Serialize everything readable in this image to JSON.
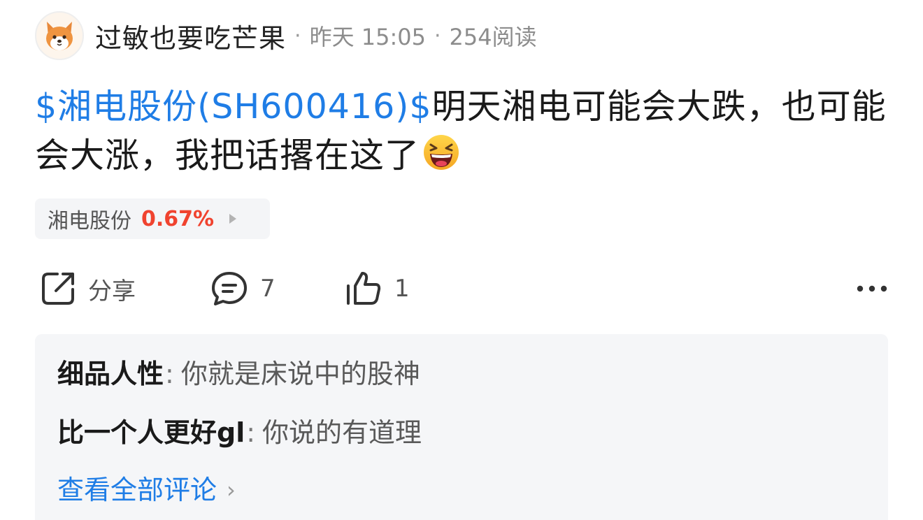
{
  "author": {
    "name": "过敏也要吃芒果",
    "time": "昨天 15:05",
    "reads": "254阅读",
    "separator": "·"
  },
  "post": {
    "stock_link": "$湘电股份(SH600416)$",
    "text": "明天湘电可能会大跌，也可能会大涨，我把话撂在这了"
  },
  "stock_chip": {
    "name": "湘电股份",
    "change": "0.67%"
  },
  "actions": {
    "share_label": "分享",
    "comment_count": "7",
    "like_count": "1"
  },
  "comments": [
    {
      "user": "细品人性",
      "separator": ":",
      "text": "你就是床说中的股神"
    },
    {
      "user": "比一个人更好gl",
      "separator": ":",
      "text": "你说的有道理"
    }
  ],
  "view_all_label": "查看全部评论",
  "colors": {
    "link_blue": "#1f7de6",
    "stock_up_red": "#f0432f",
    "comment_bg": "#f5f6f8"
  }
}
